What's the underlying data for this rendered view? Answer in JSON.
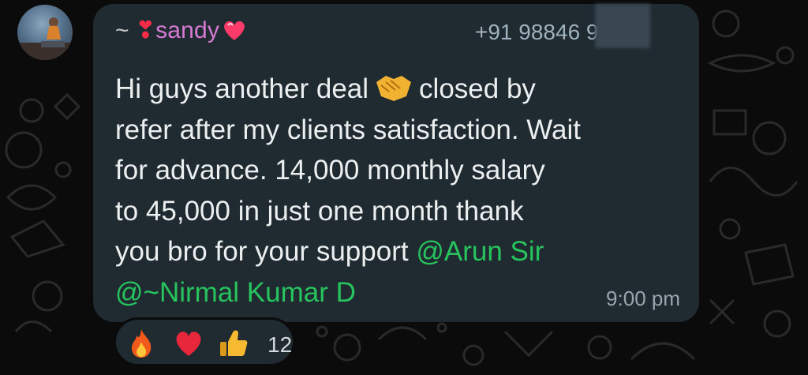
{
  "message": {
    "sender_prefix": "~",
    "sender_name": "sandy",
    "sender_heart": "❣",
    "phone": "+91 98846 9",
    "lines": [
      {
        "before": "Hi guys another deal",
        "after": "closed by"
      },
      {
        "text": "refer after my clients satisfaction. Wait"
      },
      {
        "text": "for advance. 14,000 monthly salary"
      },
      {
        "text": "to 45,000 in just one month thank"
      },
      {
        "text": "you bro for your support",
        "mention": "@Arun Sir"
      },
      {
        "mention": "@~Nirmal Kumar D"
      }
    ],
    "time": "9:00 pm"
  },
  "reactions": {
    "icons": [
      "fire-icon",
      "heart-icon",
      "thumbs-up-icon"
    ],
    "count": "12"
  },
  "colors": {
    "bubble": "#1f2a31",
    "sender": "#d67ad4",
    "mention": "#27c45e",
    "text": "#ecefef",
    "meta": "#9aa6ad"
  }
}
